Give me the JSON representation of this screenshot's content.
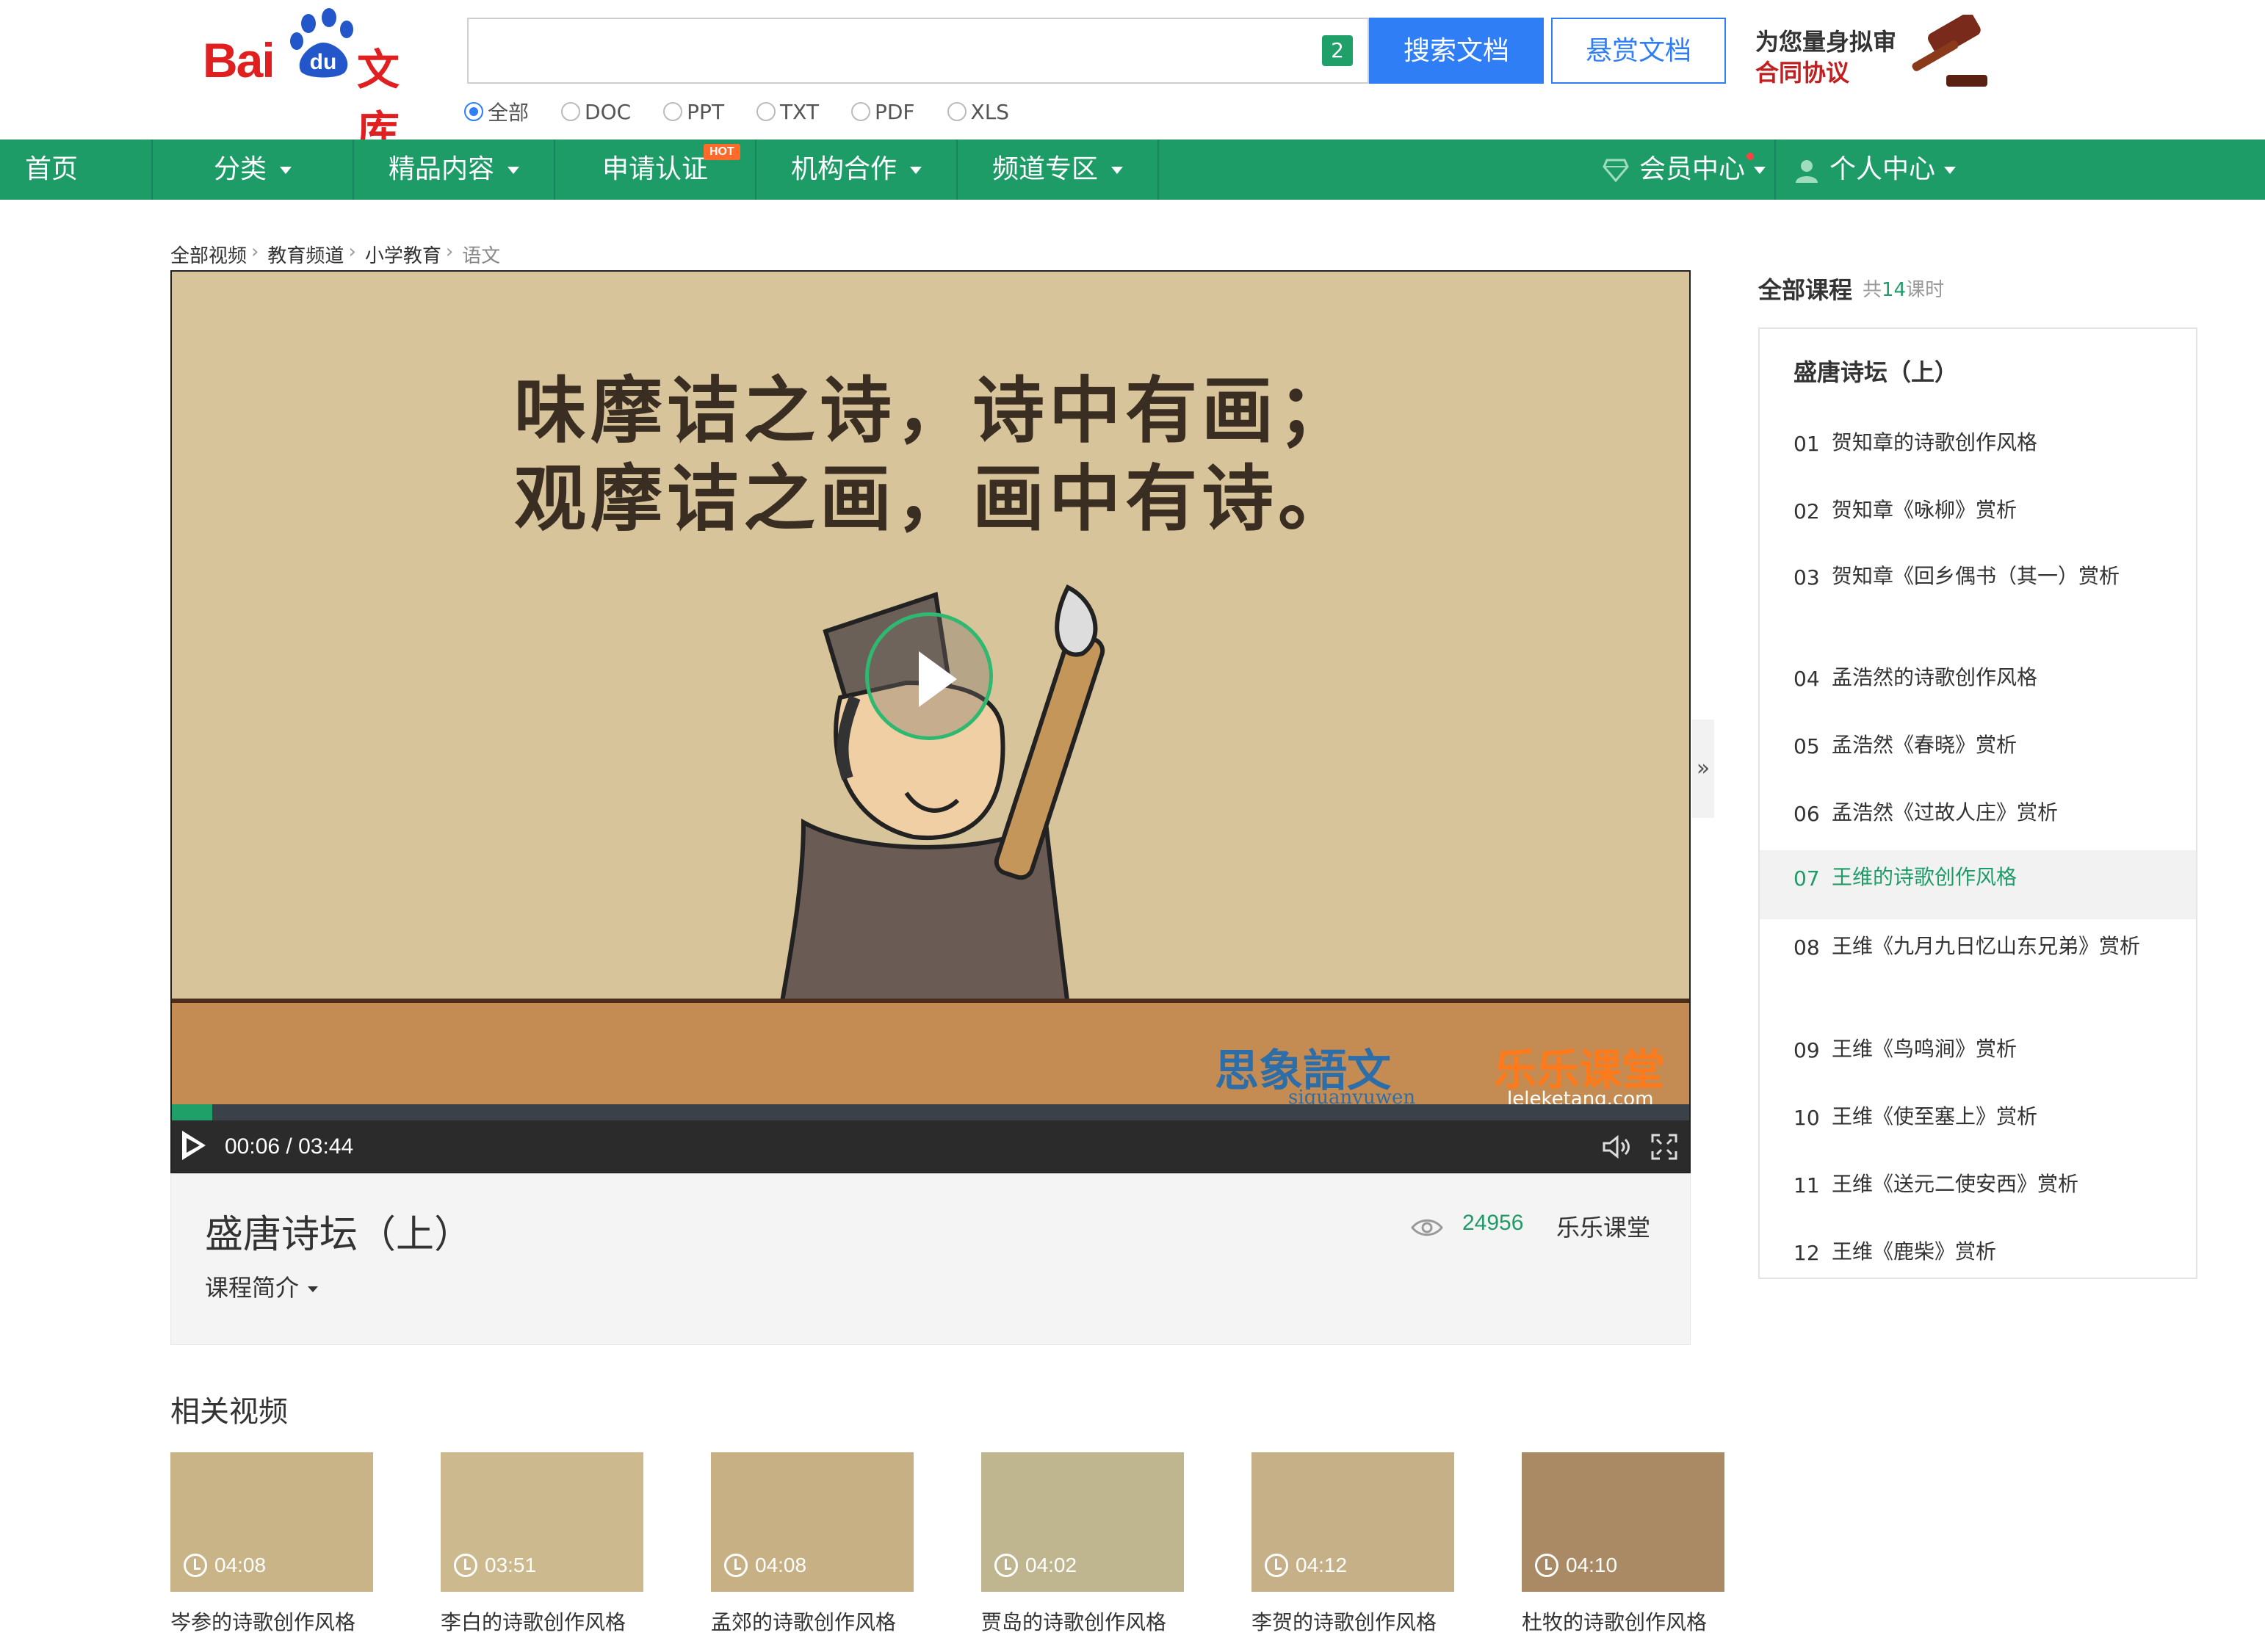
{
  "brand": {
    "logo_text": "Bai",
    "logo_du": "du",
    "logo_wenku": "文库"
  },
  "search": {
    "value": "",
    "placeholder": "",
    "badge": "2",
    "submit_label": "搜索文档",
    "reward_label": "悬赏文档"
  },
  "ad": {
    "line1": "为您量身拟审",
    "line2": "合同协议"
  },
  "filters": [
    {
      "label": "全部",
      "checked": true
    },
    {
      "label": "DOC",
      "checked": false
    },
    {
      "label": "PPT",
      "checked": false
    },
    {
      "label": "TXT",
      "checked": false
    },
    {
      "label": "PDF",
      "checked": false
    },
    {
      "label": "XLS",
      "checked": false
    }
  ],
  "nav": {
    "items": [
      "首页",
      "分类",
      "精品内容",
      "申请认证",
      "机构合作",
      "频道专区"
    ],
    "hot_badge": "HOT",
    "member": "会员中心",
    "personal": "个人中心"
  },
  "breadcrumb": [
    "全部视频",
    "教育频道",
    "小学教育",
    "语文"
  ],
  "video": {
    "poem_line1": "味摩诘之诗，诗中有画；",
    "poem_line2": "观摩诘之画，画中有诗。",
    "watermark_left": "思象語文",
    "watermark_left_sub": "siquanyuwen",
    "watermark_right": "乐乐课堂",
    "watermark_right_sub": "leleketang.com",
    "current_time": "00:06",
    "duration": "03:44",
    "time_display": "00:06 / 03:44",
    "progress": 0.0268
  },
  "course": {
    "title": "盛唐诗坛（上）",
    "intro_label": "课程简介",
    "views": "24956",
    "provider": "乐乐课堂"
  },
  "sidebar": {
    "heading": "全部课程",
    "count_prefix": "共",
    "count": "14",
    "count_suffix": "课时",
    "chapter": "盛唐诗坛（上）",
    "lessons": [
      {
        "num": "01",
        "name": "贺知章的诗歌创作风格"
      },
      {
        "num": "02",
        "name": "贺知章《咏柳》赏析"
      },
      {
        "num": "03",
        "name": "贺知章《回乡偶书（其一）赏析"
      },
      {
        "num": "04",
        "name": "孟浩然的诗歌创作风格"
      },
      {
        "num": "05",
        "name": "孟浩然《春晓》赏析"
      },
      {
        "num": "06",
        "name": "孟浩然《过故人庄》赏析"
      },
      {
        "num": "07",
        "name": "王维的诗歌创作风格",
        "active": true
      },
      {
        "num": "08",
        "name": "王维《九月九日忆山东兄弟》赏析"
      },
      {
        "num": "09",
        "name": "王维《鸟鸣涧》赏析"
      },
      {
        "num": "10",
        "name": "王维《使至塞上》赏析"
      },
      {
        "num": "11",
        "name": "王维《送元二使安西》赏析"
      },
      {
        "num": "12",
        "name": "王维《鹿柴》赏析"
      }
    ]
  },
  "related": {
    "heading": "相关视频",
    "items": [
      {
        "title": "岑参的诗歌创作风格",
        "duration": "04:08"
      },
      {
        "title": "李白的诗歌创作风格",
        "duration": "03:51"
      },
      {
        "title": "孟郊的诗歌创作风格",
        "duration": "04:08"
      },
      {
        "title": "贾岛的诗歌创作风格",
        "duration": "04:02"
      },
      {
        "title": "李贺的诗歌创作风格",
        "duration": "04:12"
      },
      {
        "title": "杜牧的诗歌创作风格",
        "duration": "04:10"
      }
    ]
  },
  "colors": {
    "brand_green": "#1e9c68",
    "search_blue": "#2f7ef5",
    "logo_red": "#e02020"
  }
}
